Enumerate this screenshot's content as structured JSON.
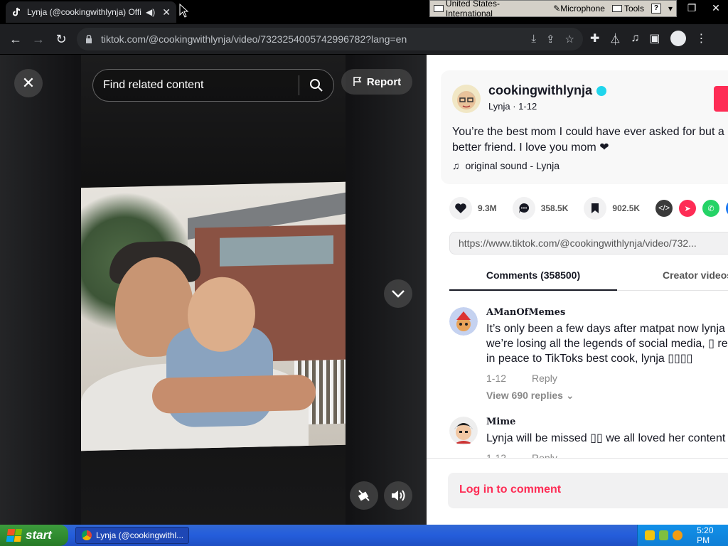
{
  "browser": {
    "tab_title": "Lynja (@cookingwithlynja) Offi",
    "url": "tiktok.com/@cookingwithlynja/video/7323254005742996782?lang=en"
  },
  "language_bar": {
    "language": "United States-International",
    "microphone": "Microphone",
    "tools": "Tools",
    "help": "?"
  },
  "player": {
    "search_placeholder": "Find related content",
    "report_label": "Report"
  },
  "post": {
    "username": "cookingwithlynja",
    "display_name": "Lynja",
    "date": "1-12",
    "caption": "You’re the best mom I could have ever asked for but a better friend. I love you mom ❤",
    "sound": "original sound - Lynja",
    "likes": "9.3M",
    "comments": "358.5K",
    "saves": "902.5K",
    "share_link": "https://www.tiktok.com/@cookingwithlynja/video/732..."
  },
  "tabs": {
    "comments": "Comments (358500)",
    "creator": "Creator videos"
  },
  "comments": [
    {
      "user": "AManOfMemes",
      "text": "It’s only been a few days after matpat now lynja we’re losing all the legends of social media, ▯ rest in peace to TikToks best cook, lynja ▯▯▯▯",
      "date": "1-12",
      "reply_label": "Reply",
      "view_replies": "View 690 replies"
    },
    {
      "user": "Mime",
      "text": "Lynja will be missed ▯▯ we all loved her content",
      "date": "1-12",
      "reply_label": "Reply"
    }
  ],
  "login_prompt": "Log in to comment",
  "taskbar": {
    "start_label": "start",
    "task_label": "Lynja (@cookingwithl...",
    "clock": "5:20 PM"
  },
  "colors": {
    "tiktok_red": "#fe2c55",
    "verified": "#20d5ec",
    "xp_blue": "#245ddb",
    "xp_green": "#2f8a2f"
  }
}
